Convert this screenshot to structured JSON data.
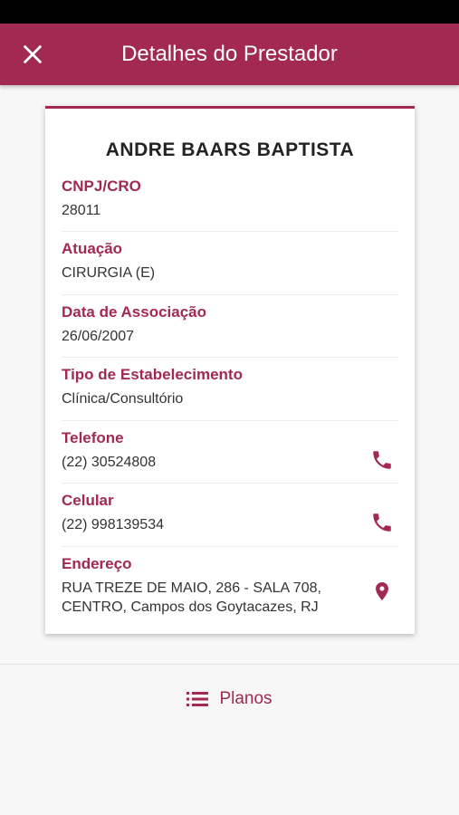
{
  "appbar": {
    "title": "Detalhes do Prestador"
  },
  "provider": {
    "name": "ANDRE BAARS BAPTISTA"
  },
  "fields": {
    "cnpj": {
      "label": "CNPJ/CRO",
      "value": "28011"
    },
    "atuacao": {
      "label": "Atuação",
      "value": "CIRURGIA (E)"
    },
    "data_associacao": {
      "label": "Data de Associação",
      "value": "26/06/2007"
    },
    "tipo_estabelecimento": {
      "label": "Tipo de Estabelecimento",
      "value": "Clínica/Consultório"
    },
    "telefone": {
      "label": "Telefone",
      "value": "(22) 30524808",
      "icon": "phone-icon"
    },
    "celular": {
      "label": "Celular",
      "value": "(22) 998139534",
      "icon": "phone-icon"
    },
    "endereco": {
      "label": "Endereço",
      "value": "RUA TREZE DE MAIO, 286 - SALA 708, CENTRO, Campos dos Goytacazes, RJ",
      "icon": "location-pin-icon"
    }
  },
  "bottom": {
    "planos_label": "Planos",
    "icon": "list-icon"
  },
  "colors": {
    "accent": "#a22a52",
    "background": "#f7f7f7",
    "statusbar": "#000000"
  }
}
